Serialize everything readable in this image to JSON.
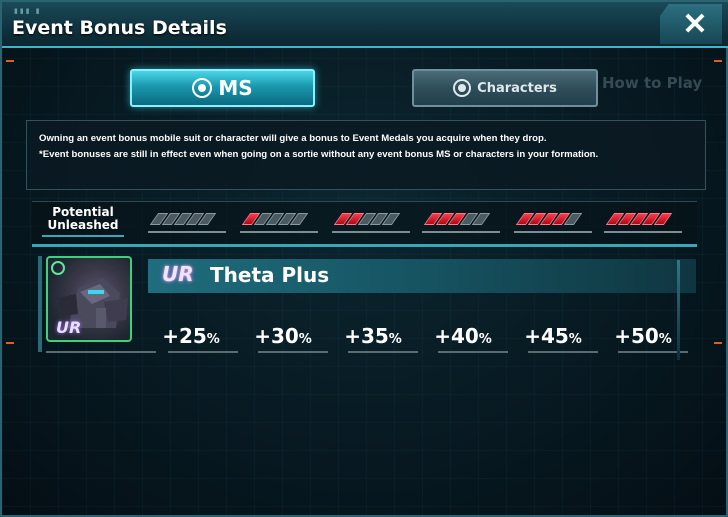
{
  "window": {
    "title": "Event Bonus Details",
    "title_dots": "▮▮▮ ▮",
    "close_label": "✕"
  },
  "tabs": [
    {
      "label": "MS",
      "icon": "crosshair-icon",
      "active": true
    },
    {
      "label": "Characters",
      "icon": "crosshair-icon",
      "active": false
    }
  ],
  "ghost_link": "How to Play",
  "description": {
    "line1": "Owning an event bonus mobile suit or character will give a bonus to Event Medals you acquire when they drop.",
    "line2": "*Event bonuses are still in effect even when going on a sortie without any event bonus MS or characters in your formation."
  },
  "potential": {
    "label_line1": "Potential",
    "label_line2": "Unleashed",
    "stages_filled": [
      0,
      1,
      2,
      3,
      4,
      5
    ],
    "stage_total": 5
  },
  "unit": {
    "rarity": "UR",
    "name": "Theta Plus",
    "bonuses": [
      {
        "value": "+25",
        "unit": "%"
      },
      {
        "value": "+30",
        "unit": "%"
      },
      {
        "value": "+35",
        "unit": "%"
      },
      {
        "value": "+40",
        "unit": "%"
      },
      {
        "value": "+45",
        "unit": "%"
      },
      {
        "value": "+50",
        "unit": "%"
      }
    ]
  },
  "colors": {
    "accent": "#3fb6c8",
    "active_tab": "#1a98ae",
    "stage_on": "#d81a2a",
    "stage_off": "#4a5a60"
  }
}
